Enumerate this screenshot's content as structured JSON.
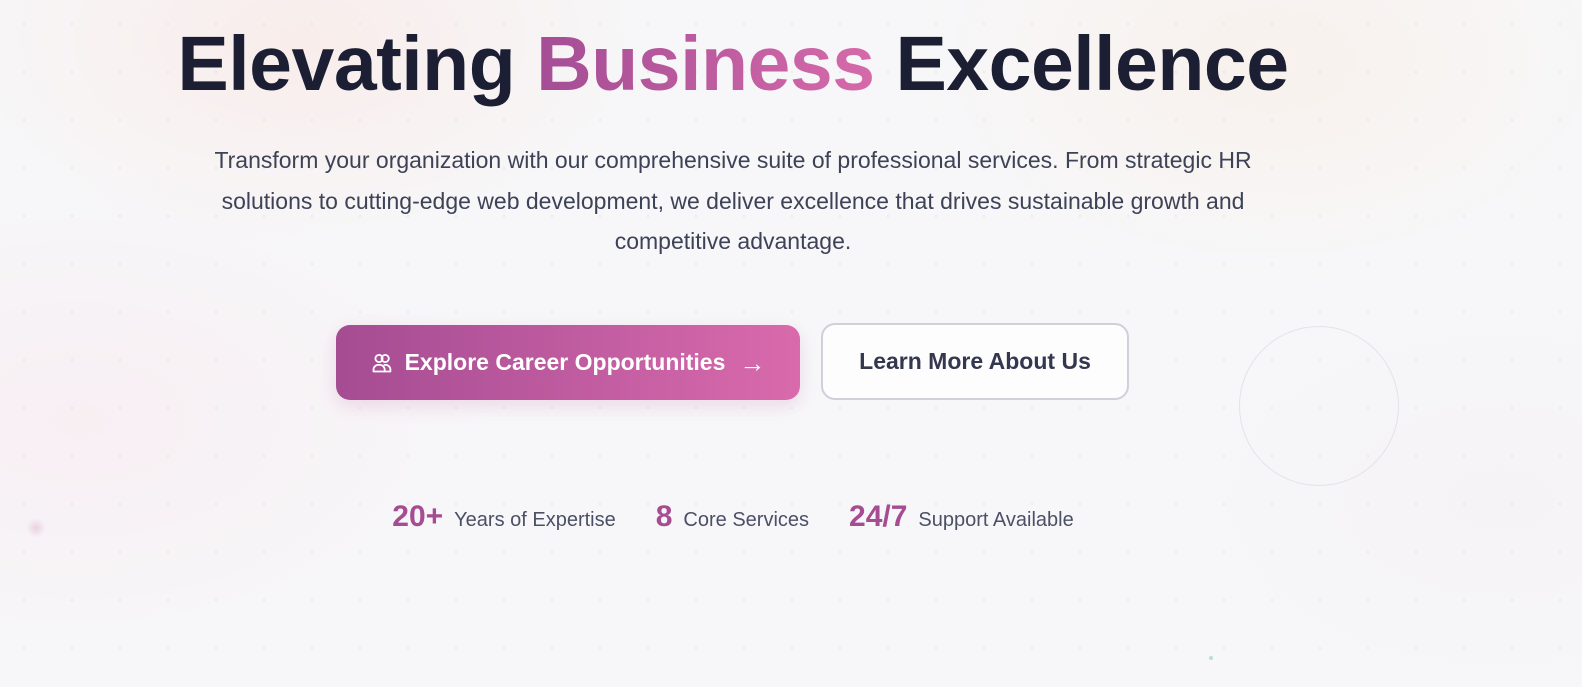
{
  "hero": {
    "title_part1": "Elevating",
    "title_accent": "Business",
    "title_part2": "Excellence",
    "subtitle": "Transform your organization with our comprehensive suite of professional services. From strategic HR solutions to cutting-edge web development, we deliver excellence that drives sustainable growth and competitive advantage."
  },
  "actions": {
    "primary_label": "Explore Career Opportunities",
    "primary_icon": "users-icon",
    "primary_trailing_icon": "arrow-right-icon",
    "secondary_label": "Learn More About Us"
  },
  "stats": [
    {
      "value": "20+",
      "label": "Years of Expertise"
    },
    {
      "value": "8",
      "label": "Core Services"
    },
    {
      "value": "24/7",
      "label": "Support Available"
    }
  ],
  "colors": {
    "accent_start": "#a54c93",
    "accent_end": "#d96aac",
    "heading": "#1c1f33",
    "body_text": "#3d4256"
  }
}
